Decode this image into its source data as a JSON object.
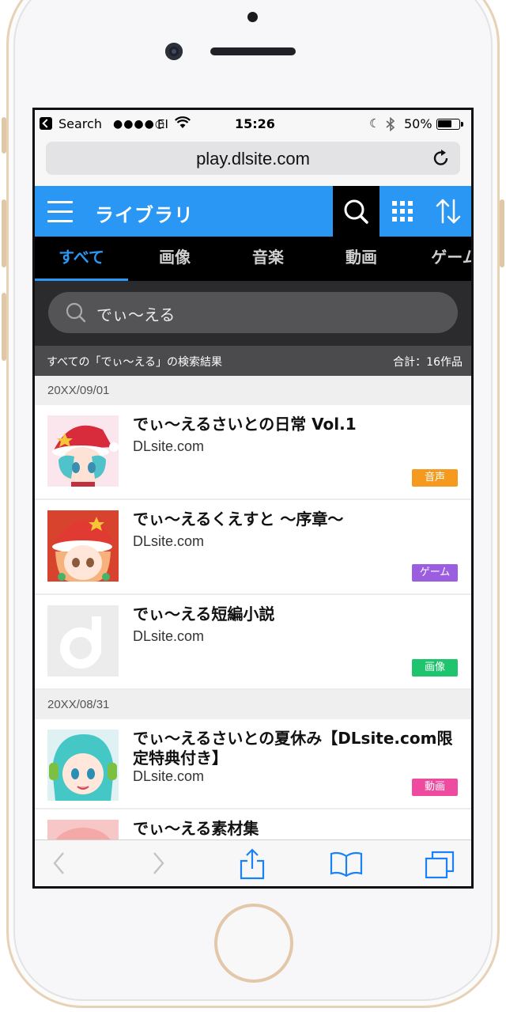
{
  "status_bar": {
    "back_app": "Search",
    "signal": "●●●●○",
    "carrier": "EI",
    "time": "15:26",
    "battery": "50%"
  },
  "browser": {
    "url": "play.dlsite.com"
  },
  "app": {
    "title": "ライブラリ"
  },
  "tabs": [
    {
      "label": "すべて",
      "active": true
    },
    {
      "label": "画像",
      "active": false
    },
    {
      "label": "音楽",
      "active": false
    },
    {
      "label": "動画",
      "active": false
    },
    {
      "label": "ゲーム",
      "active": false
    }
  ],
  "search": {
    "query": "でぃ〜える"
  },
  "results": {
    "summary": "すべての「でぃ〜える」の検索結果",
    "total": "合計：16作品"
  },
  "groups": [
    {
      "date": "20XX/09/01",
      "items": [
        {
          "title": "でぃ〜えるさいとの日常 Vol.1",
          "site": "DLsite.com",
          "badge": "音声",
          "badge_color": "#f59a1f"
        },
        {
          "title": "でぃ〜えるくえすと 〜序章〜",
          "site": "DLsite.com",
          "badge": "ゲーム",
          "badge_color": "#9b5ee0"
        },
        {
          "title": "でぃ〜える短編小説",
          "site": "DLsite.com",
          "badge": "画像",
          "badge_color": "#1fc46e"
        }
      ]
    },
    {
      "date": "20XX/08/31",
      "items": [
        {
          "title": "でぃ〜えるさいとの夏休み【DLsite.com限定特典付き】",
          "site": "DLsite.com",
          "badge": "動画",
          "badge_color": "#ee4aa0"
        },
        {
          "title": "でぃ〜える素材集",
          "site": "",
          "badge": "",
          "badge_color": ""
        }
      ]
    }
  ],
  "colors": {
    "accent": "#2a97f5",
    "header_bg": "#2a97f5",
    "tab_bg": "#000000"
  }
}
